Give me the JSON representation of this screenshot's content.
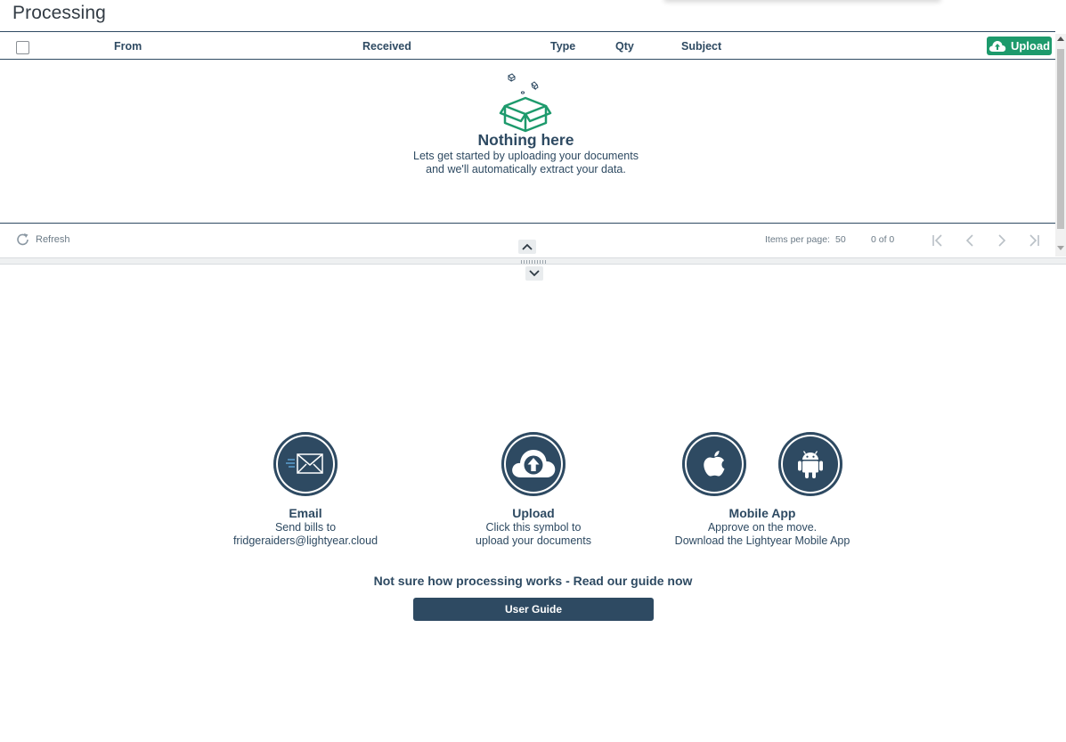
{
  "page": {
    "title": "Processing"
  },
  "grid": {
    "columns": {
      "from": "From",
      "received": "Received",
      "type": "Type",
      "qty": "Qty",
      "subject": "Subject"
    },
    "upload_label": "Upload",
    "empty": {
      "title": "Nothing here",
      "line1": "Lets get started by uploading your documents",
      "line2": "and we'll automatically extract your data."
    },
    "footer": {
      "refresh_label": "Refresh",
      "items_per_page_label": "Items per page:",
      "items_per_page_value": "50",
      "page_count": "0 of 0"
    }
  },
  "info": {
    "email": {
      "title": "Email",
      "line1": "Send bills to",
      "line2": "fridgeraiders@lightyear.cloud"
    },
    "upload": {
      "title": "Upload",
      "line1": "Click this symbol to",
      "line2": "upload your documents"
    },
    "mobile": {
      "title": "Mobile App",
      "line1": "Approve on the move.",
      "line2": "Download the Lightyear Mobile App"
    },
    "guide_text": "Not sure how processing works - Read our guide now",
    "guide_button": "User Guide"
  },
  "colors": {
    "primary": "#2e4a62",
    "accent_green": "#1d9a6c",
    "muted_text": "#6b7a86"
  },
  "icons": {
    "upload_button": "cloud-upload-icon",
    "empty_state": "open-box-icon",
    "refresh": "refresh-icon",
    "pager": [
      "first-page-icon",
      "prev-page-icon",
      "next-page-icon",
      "last-page-icon"
    ],
    "email": "envelope-icon",
    "upload": "cloud-upload-icon",
    "apple": "apple-icon",
    "android": "android-icon"
  }
}
